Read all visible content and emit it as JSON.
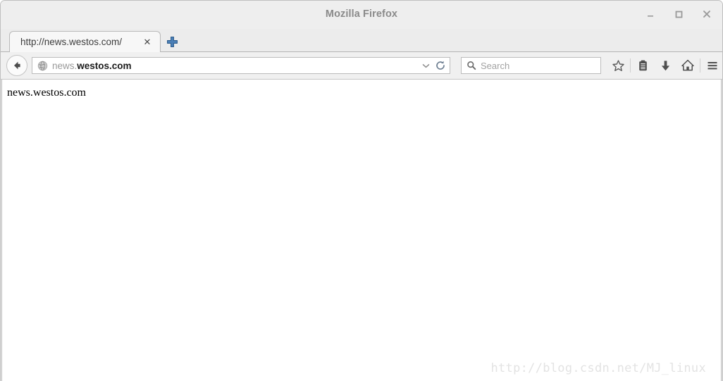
{
  "window": {
    "title": "Mozilla Firefox",
    "controls": {
      "minimize": "minimize",
      "maximize": "maximize",
      "close": "close"
    }
  },
  "tabstrip": {
    "tabs": [
      {
        "label": "http://news.westos.com/",
        "close_label": "✕",
        "active": true
      }
    ],
    "new_tab_label": "+"
  },
  "toolbar": {
    "back_label": "Back",
    "url": {
      "prefix": "news.",
      "domain": "westos.com",
      "full": "news.westos.com",
      "dropdown_label": "⌄",
      "reload_label": "Reload",
      "icon": "globe-icon"
    },
    "search": {
      "placeholder": "Search",
      "icon": "search-icon"
    },
    "buttons": [
      {
        "name": "bookmark-star-button",
        "icon": "star-icon"
      },
      {
        "name": "reader-list-button",
        "icon": "clipboard-icon"
      },
      {
        "name": "downloads-button",
        "icon": "download-arrow-icon"
      },
      {
        "name": "home-button",
        "icon": "home-icon"
      },
      {
        "name": "menu-button",
        "icon": "hamburger-menu-icon"
      }
    ]
  },
  "page": {
    "body_text": "news.westos.com",
    "watermark": "http://blog.csdn.net/MJ_linux"
  },
  "colors": {
    "chrome_bg": "#ededec",
    "tabstrip_bg": "#ececec",
    "active_tab_bg": "#f7f7f7",
    "navbar_bg": "#f0f0f0",
    "accent_blue": "#3a6ea5",
    "text_muted": "#8a8a8a",
    "watermark": "#e3e3e3"
  }
}
